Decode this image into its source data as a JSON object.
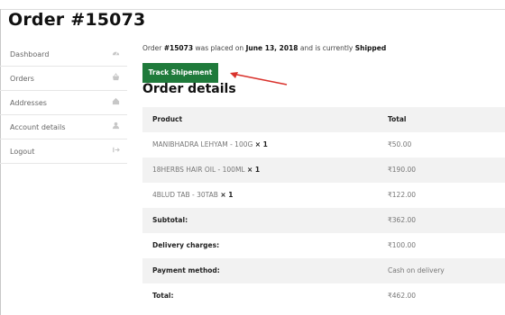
{
  "page": {
    "title": "Order #15073"
  },
  "sidebar": {
    "items": [
      {
        "label": "Dashboard",
        "icon": "dashboard-icon"
      },
      {
        "label": "Orders",
        "icon": "basket-icon"
      },
      {
        "label": "Addresses",
        "icon": "home-icon"
      },
      {
        "label": "Account details",
        "icon": "user-icon"
      },
      {
        "label": "Logout",
        "icon": "logout-icon"
      }
    ]
  },
  "notice": {
    "prefix": "Order ",
    "order_number": "#15073",
    "mid1": " was placed on ",
    "date": "June 13, 2018",
    "mid2": " and is currently ",
    "status": "Shipped"
  },
  "track_button": {
    "label": "Track Shipement",
    "color": "#1f7a3b"
  },
  "annotation": {
    "arrow_color": "#d9322c"
  },
  "order_details": {
    "title": "Order details",
    "headers": {
      "product": "Product",
      "total": "Total"
    },
    "items": [
      {
        "name": "MANIBHADRA LEHYAM - 100G",
        "qty": "× 1",
        "total": "₹50.00"
      },
      {
        "name": "18HERBS HAIR OIL - 100ML",
        "qty": "× 1",
        "total": "₹190.00"
      },
      {
        "name": "4BLUD TAB - 30TAB",
        "qty": "× 1",
        "total": "₹122.00"
      }
    ],
    "totals": [
      {
        "label": "Subtotal:",
        "value": "₹362.00"
      },
      {
        "label": "Delivery charges:",
        "value": "₹100.00"
      },
      {
        "label": "Payment method:",
        "value": "Cash on delivery"
      },
      {
        "label": "Total:",
        "value": "₹462.00"
      }
    ]
  }
}
